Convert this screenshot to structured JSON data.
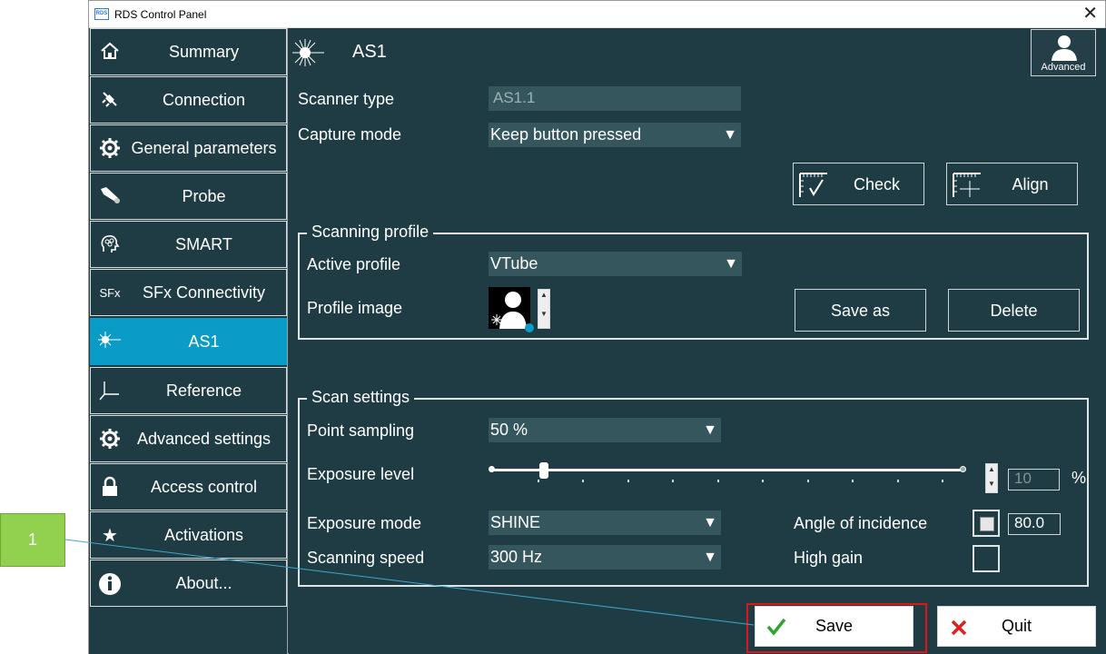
{
  "window": {
    "title": "RDS Control Panel",
    "app_icon_text": "RDS"
  },
  "sidebar": {
    "items": [
      {
        "label": "Summary",
        "icon": "home-icon"
      },
      {
        "label": "Connection",
        "icon": "plug-icon"
      },
      {
        "label": "General parameters",
        "icon": "gear-icon"
      },
      {
        "label": "Probe",
        "icon": "probe-icon"
      },
      {
        "label": "SMART",
        "icon": "brain-icon"
      },
      {
        "label": "SFx Connectivity",
        "icon": "sfx-icon",
        "icon_text": "SFx"
      },
      {
        "label": "AS1",
        "icon": "laser-icon",
        "active": true
      },
      {
        "label": "Reference",
        "icon": "axes-icon"
      },
      {
        "label": "Advanced settings",
        "icon": "gear-icon"
      },
      {
        "label": "Access control",
        "icon": "lock-icon"
      },
      {
        "label": "Activations",
        "icon": "star-icon"
      },
      {
        "label": "About...",
        "icon": "info-icon"
      }
    ],
    "active_color": "#0a9bc7"
  },
  "header": {
    "title": "AS1",
    "advanced_label": "Advanced"
  },
  "scanner": {
    "type_label": "Scanner type",
    "type_value": "AS1.1",
    "capture_label": "Capture mode",
    "capture_value": "Keep button pressed",
    "check_label": "Check",
    "align_label": "Align"
  },
  "scanning_profile": {
    "title": "Scanning profile",
    "active_label": "Active profile",
    "active_value": "VTube",
    "image_label": "Profile image",
    "save_as_label": "Save as",
    "delete_label": "Delete"
  },
  "scan_settings": {
    "title": "Scan settings",
    "point_sampling_label": "Point sampling",
    "point_sampling_value": "50 %",
    "exposure_level_label": "Exposure level",
    "exposure_level_slider_fraction": 0.11,
    "exposure_level_value": "10",
    "exposure_level_unit": "%",
    "exposure_mode_label": "Exposure mode",
    "exposure_mode_value": "SHINE",
    "scanning_speed_label": "Scanning speed",
    "scanning_speed_value": "300 Hz",
    "angle_label": "Angle of incidence",
    "angle_checked": true,
    "angle_value": "80.0",
    "high_gain_label": "High gain",
    "high_gain_checked": false
  },
  "footer": {
    "save_label": "Save",
    "quit_label": "Quit"
  },
  "annotation": {
    "label": "1",
    "color": "#92d050",
    "highlight_color": "#e01616"
  }
}
